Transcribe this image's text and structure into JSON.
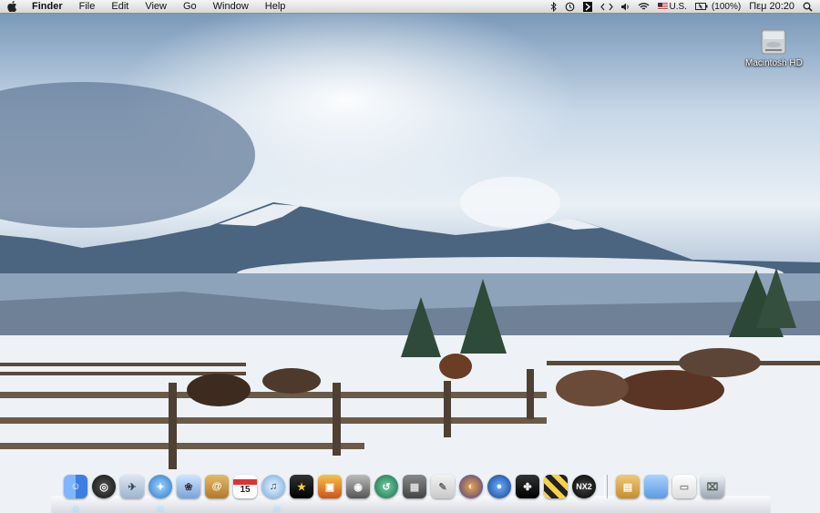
{
  "menubar": {
    "app_name": "Finder",
    "menus": [
      "File",
      "Edit",
      "View",
      "Go",
      "Window",
      "Help"
    ],
    "status": {
      "input_source": "U.S.",
      "battery": "(100%)",
      "clock": "Πεμ 20:20"
    }
  },
  "desktop": {
    "drive_label": "Macintosh HD"
  },
  "dock": {
    "calendar_day": "15",
    "nx_label": "NX2"
  },
  "colors": {
    "menubar": "#e6e6e6",
    "sky": "#c8d8e8",
    "snow": "#f4f6f9"
  }
}
